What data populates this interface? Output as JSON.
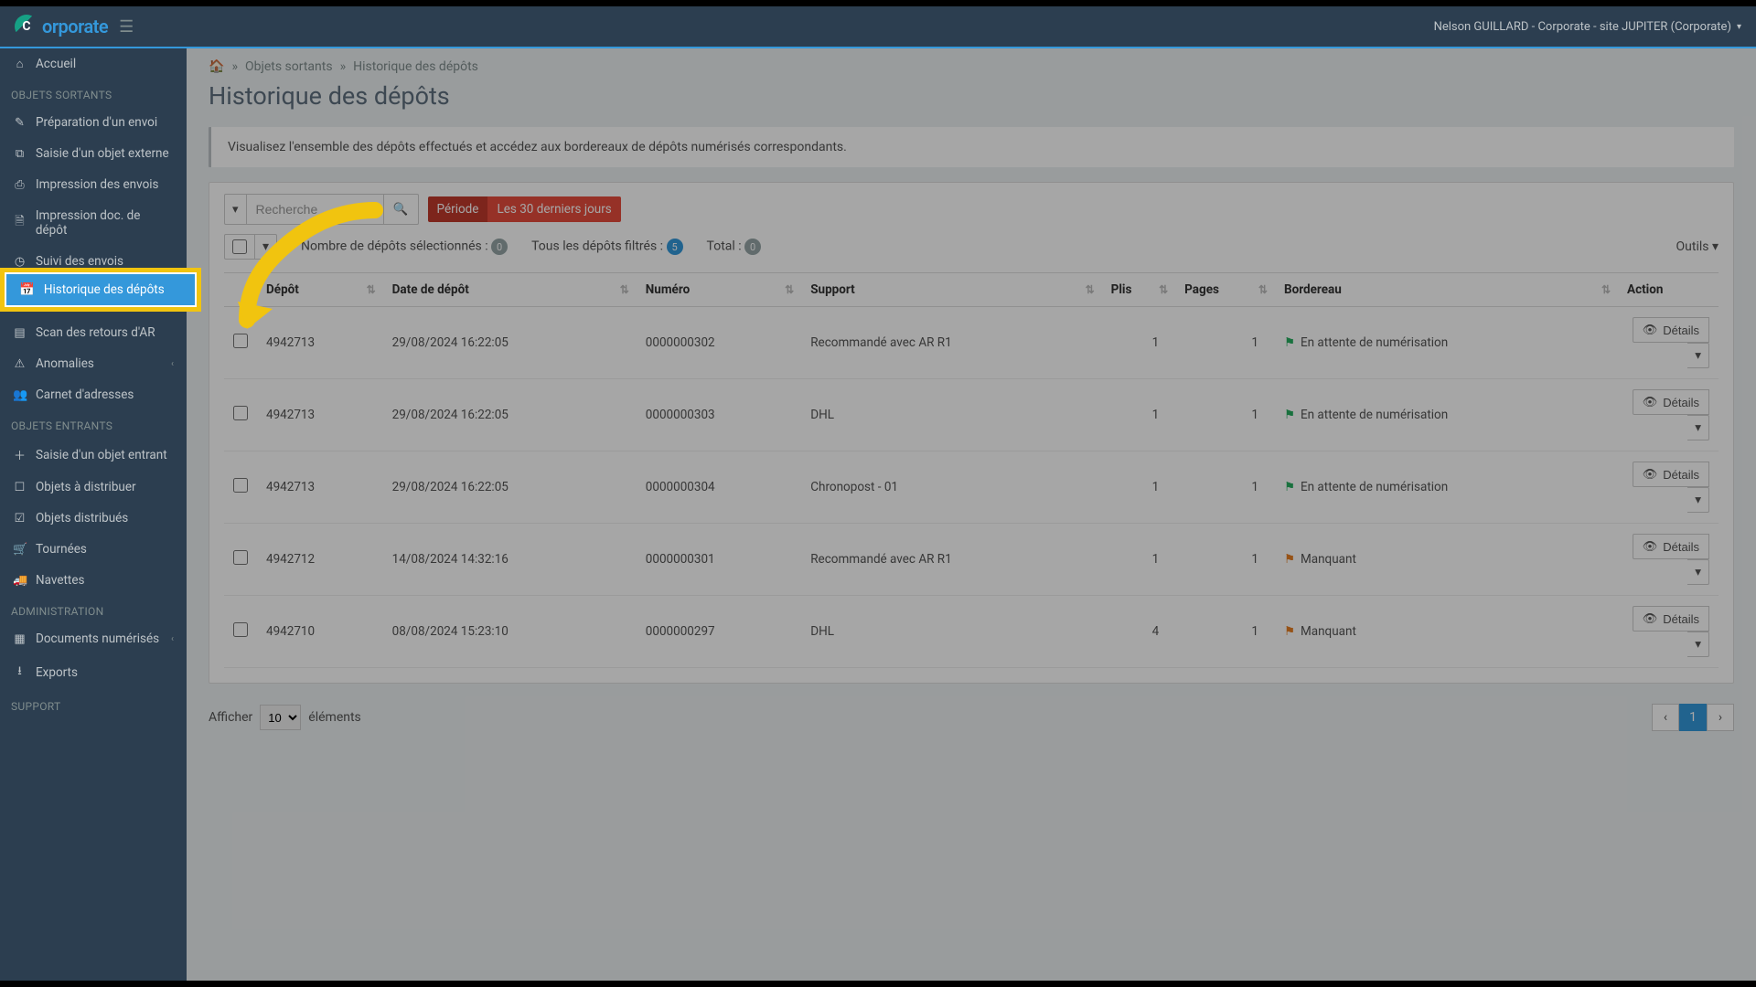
{
  "brand": {
    "name": "orporate"
  },
  "header": {
    "user_context": "Nelson GUILLARD - Corporate - site JUPITER (Corporate)"
  },
  "sidebar": {
    "home": "Accueil",
    "sections": {
      "sortants": "OBJETS SORTANTS",
      "entrants": "OBJETS ENTRANTS",
      "admin": "ADMINISTRATION",
      "support": "SUPPORT"
    },
    "items": {
      "prep": "Préparation d'un envoi",
      "saisie_ext": "Saisie d'un objet externe",
      "impr_envois": "Impression des envois",
      "impr_doc": "Impression doc. de dépôt",
      "suivi": "Suivi des envois",
      "histo": "Historique des dépôts",
      "scan_ar": "Scan des retours d'AR",
      "anom": "Anomalies",
      "carnet": "Carnet d'adresses",
      "saisie_ent": "Saisie d'un objet entrant",
      "obj_dist": "Objets à distribuer",
      "obj_distd": "Objets distribués",
      "tournees": "Tournées",
      "navettes": "Navettes",
      "docnum": "Documents numérisés",
      "exports": "Exports"
    }
  },
  "breadcrumb": {
    "l1": "Objets sortants",
    "l2": "Historique des dépôts"
  },
  "page": {
    "title": "Historique des dépôts",
    "desc": "Visualisez l'ensemble des dépôts effectués et accédez aux bordereaux de dépôts numérisés correspondants."
  },
  "search": {
    "placeholder": "Recherche"
  },
  "period": {
    "label": "Période",
    "value": "Les 30 derniers jours"
  },
  "stats": {
    "sel_label": "Nombre de dépôts sélectionnés :",
    "sel_count": "0",
    "filt_label": "Tous les dépôts filtrés :",
    "filt_count": "5",
    "total_label": "Total :",
    "total_count": "0",
    "outils": "Outils"
  },
  "table": {
    "headers": {
      "depot": "Dépôt",
      "date": "Date de dépôt",
      "numero": "Numéro",
      "support": "Support",
      "plis": "Plis",
      "pages": "Pages",
      "bordereau": "Bordereau",
      "action": "Action"
    },
    "status": {
      "pending": "En attente de numérisation",
      "missing": "Manquant"
    },
    "details": "Détails",
    "rows": [
      {
        "depot": "4942713",
        "date": "29/08/2024 16:22:05",
        "numero": "0000000302",
        "support": "Recommandé avec AR R1",
        "plis": "1",
        "pages": "1",
        "bord": "pending"
      },
      {
        "depot": "4942713",
        "date": "29/08/2024 16:22:05",
        "numero": "0000000303",
        "support": "DHL",
        "plis": "1",
        "pages": "1",
        "bord": "pending"
      },
      {
        "depot": "4942713",
        "date": "29/08/2024 16:22:05",
        "numero": "0000000304",
        "support": "Chronopost - 01",
        "plis": "1",
        "pages": "1",
        "bord": "pending"
      },
      {
        "depot": "4942712",
        "date": "14/08/2024 14:32:16",
        "numero": "0000000301",
        "support": "Recommandé avec AR R1",
        "plis": "1",
        "pages": "1",
        "bord": "missing"
      },
      {
        "depot": "4942710",
        "date": "08/08/2024 15:23:10",
        "numero": "0000000297",
        "support": "DHL",
        "plis": "4",
        "pages": "1",
        "bord": "missing"
      }
    ]
  },
  "footer": {
    "show": "Afficher",
    "elements": "éléments",
    "len": "10",
    "page": "1"
  },
  "colors": {
    "accent": "#3498db",
    "danger": "#e74c3c",
    "highlight": "#f1c40f"
  }
}
